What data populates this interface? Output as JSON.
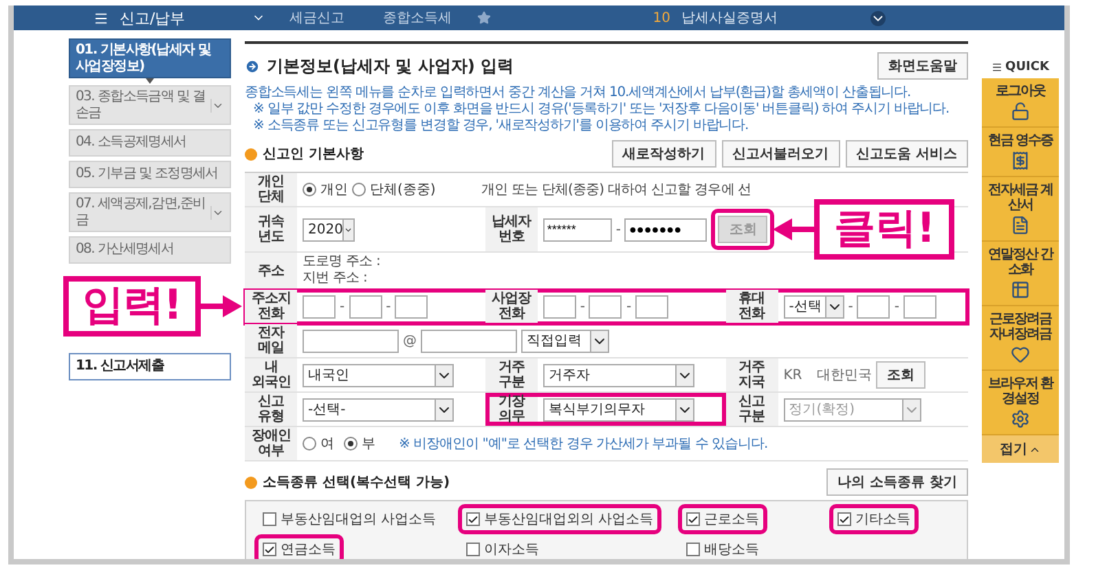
{
  "header": {
    "menu_title": "신고/납부",
    "breadcrumbs": [
      "세금신고",
      "종합소득세"
    ],
    "step_number": "10",
    "step_title": "납세사실증명서"
  },
  "nav_items": [
    {
      "label": "01. 기본사항(납세자 및 사업장정보)",
      "selected": true,
      "kind": "step",
      "expandable": false
    },
    {
      "label": "03. 종합소득금액 및 결손금",
      "selected": false,
      "kind": "step",
      "expandable": true
    },
    {
      "label": "04. 소득공제명세서",
      "selected": false,
      "kind": "step",
      "expandable": false
    },
    {
      "label": "05. 기부금 및 조정명세서",
      "selected": false,
      "kind": "step",
      "expandable": false
    },
    {
      "label": "07. 세액공제,감면,준비금",
      "selected": false,
      "kind": "step",
      "expandable": true
    },
    {
      "label": "08. 가산세명세서",
      "selected": false,
      "kind": "step",
      "expandable": false
    },
    {
      "label": "11. 신고서제출",
      "selected": false,
      "kind": "final",
      "expandable": false
    }
  ],
  "page_title": "기본정보(납세자 및 사업자) 입력",
  "help_button": "화면도움말",
  "notes": [
    "종합소득세는 왼쪽 메뉴를 순차로 입력하면서 중간 계산을 거쳐 10.세액계산에서 납부(환급)할 총세액이 산출됩니다.",
    "※ 일부 값만 수정한 경우에도 이후 화면을 반드시 경유('등록하기' 또는 '저장후 다음이동' 버튼클릭) 하여 주시기 바랍니다.",
    "※ 소득종류 또는 신고유형를 변경할 경우, '새로작성하기'를 이용하여 주시기 바랍니다."
  ],
  "basic_section": {
    "title": "신고인 기본사항",
    "buttons": [
      "새로작성하기",
      "신고서불러오기",
      "신고도움 서비스"
    ]
  },
  "form": {
    "entity": {
      "label": "개인 단체",
      "options": [
        {
          "label": "개인",
          "selected": true
        },
        {
          "label": "단체(종중)",
          "selected": false
        }
      ],
      "note": "개인 또는 단체(종중) 대하여 신고할 경우에 선"
    },
    "year": {
      "label": "귀속 년도",
      "value": "2020"
    },
    "taxpayer_id": {
      "label": "납세자 번호",
      "first": "******",
      "separator": "-",
      "second": "●●●●●●●",
      "button": "조회",
      "button_disabled": true,
      "highlighted": true,
      "callout": "클릭!"
    },
    "address": {
      "label": "주소",
      "lines": [
        "도로명 주소 :",
        "지번 주소 :"
      ]
    },
    "phones": {
      "highlighted": true,
      "callout": "입력!",
      "separator": "-",
      "home_label": "주소지 전화",
      "business_label": "사업장 전화",
      "mobile_label": "휴대 전화",
      "mobile_prefix": "-선택"
    },
    "email": {
      "label": "전자 메일",
      "at": "@",
      "domain_select": "직접입력"
    },
    "nationality": {
      "label": "내 외국인",
      "value": "내국인"
    },
    "residence": {
      "label": "거주 구분",
      "value": "거주자"
    },
    "country": {
      "label": "거주 지국",
      "code": "KR",
      "name": "대한민국",
      "button": "조회"
    },
    "filing_type": {
      "label": "신고 유형",
      "value": "-선택-",
      "disabled": false
    },
    "bookkeeping": {
      "label": "기장 의무",
      "value": "복식부기의무자",
      "highlighted": true
    },
    "filing_class": {
      "label": "신고 구분",
      "value": "정기(확정)",
      "disabled": true
    },
    "disabled_person": {
      "label": "장애인 여부",
      "options": [
        {
          "label": "여",
          "selected": false
        },
        {
          "label": "부",
          "selected": true
        }
      ],
      "note": "※ 비장애인이 \"예\"로 선택한 경우 가산세가 부과될 수 있습니다."
    }
  },
  "income_section": {
    "title": "소득종류 선택(복수선택 가능)",
    "button": "나의 소득종류 찾기",
    "options": [
      {
        "label": "부동산임대업의 사업소득",
        "checked": false,
        "highlighted": false
      },
      {
        "label": "부동산임대업외의 사업소득",
        "checked": true,
        "highlighted": true
      },
      {
        "label": "근로소득",
        "checked": true,
        "highlighted": true
      },
      {
        "label": "기타소득",
        "checked": true,
        "highlighted": true
      },
      {
        "label": "연금소득",
        "checked": true,
        "highlighted": true
      },
      {
        "label": "이자소득",
        "checked": false,
        "highlighted": false
      },
      {
        "label": "배당소득",
        "checked": false,
        "highlighted": false
      }
    ]
  },
  "quick": {
    "title": "QUICK",
    "items": [
      {
        "label": "로그아웃"
      },
      {
        "label": "현금 영수증"
      },
      {
        "label": "전자세금 계산서"
      },
      {
        "label": "연말정산 간소화"
      },
      {
        "label": "근로장려금 자녀장려금"
      },
      {
        "label": "브라우저 환경설정"
      }
    ],
    "collapse": "접기"
  }
}
